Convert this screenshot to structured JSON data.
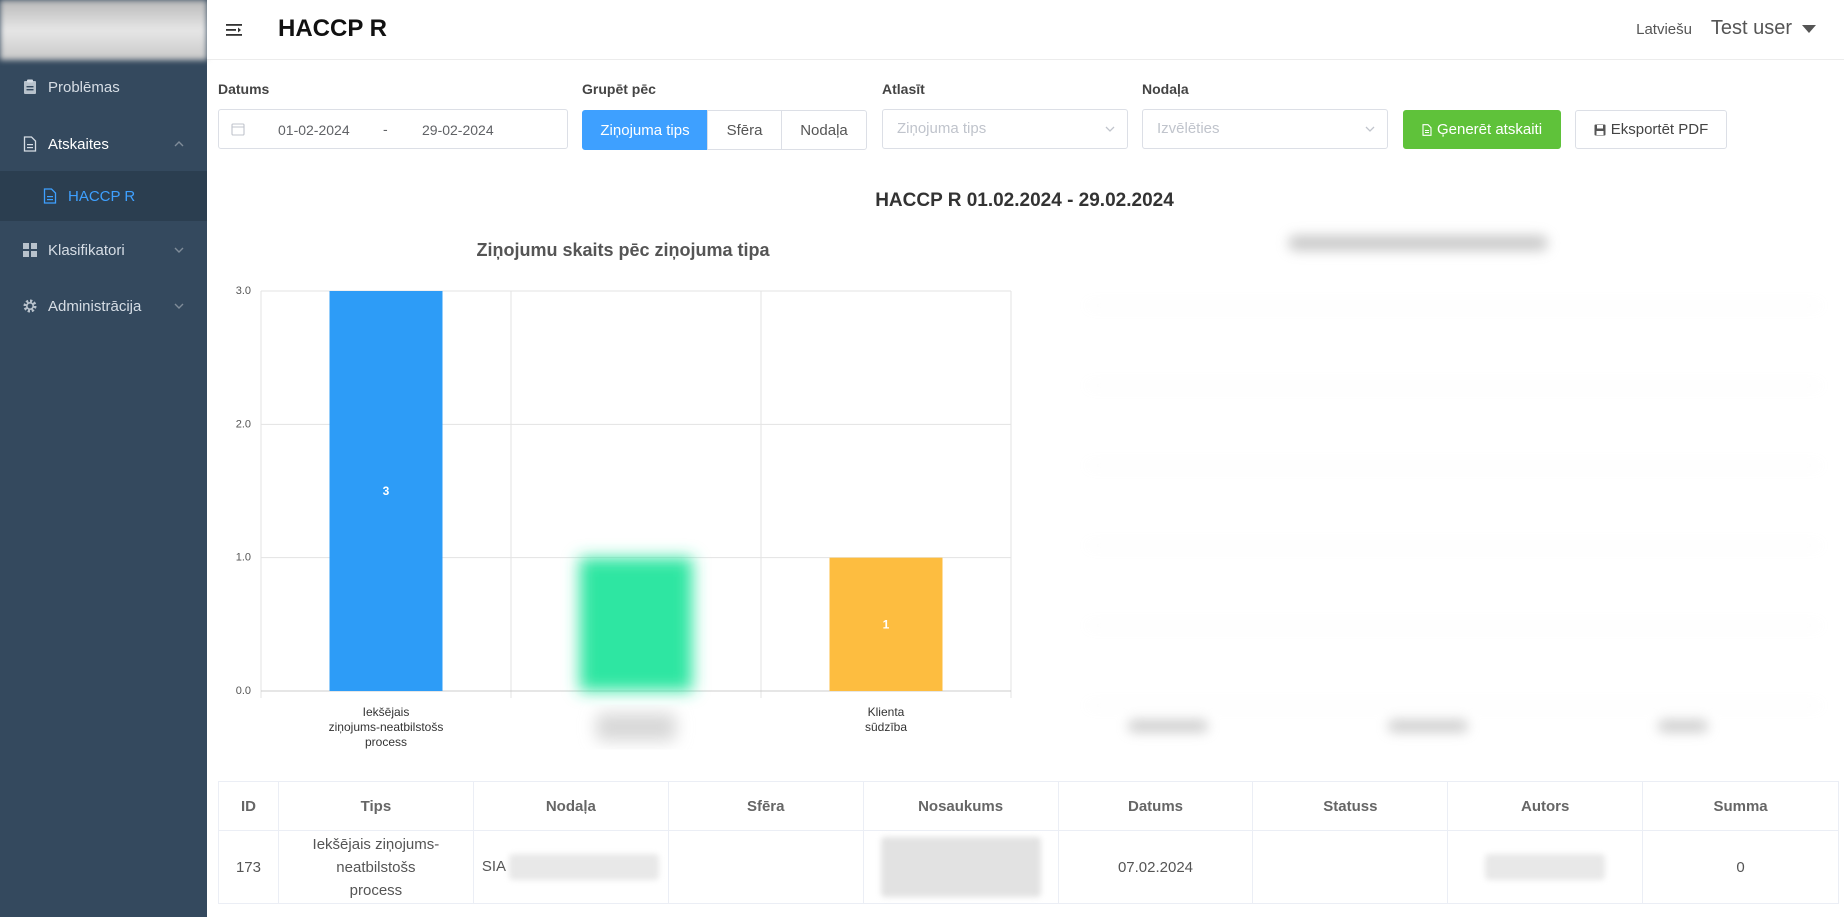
{
  "app": {
    "page_title": "HACCP R"
  },
  "header": {
    "language": "Latviešu",
    "user": "Test user"
  },
  "sidebar": {
    "items": [
      {
        "label": "Problēmas",
        "icon": "clipboard-icon"
      },
      {
        "label": "Atskaites",
        "icon": "document-icon"
      },
      {
        "label": "HACCP R",
        "icon": "file-icon"
      },
      {
        "label": "Klasifikatori",
        "icon": "grid-icon"
      },
      {
        "label": "Administrācija",
        "icon": "gear-icon"
      }
    ]
  },
  "filters": {
    "date_label": "Datums",
    "date_from": "01-02-2024",
    "date_separator": "-",
    "date_to": "29-02-2024",
    "group_label": "Grupēt pēc",
    "group_options": [
      "Ziņojuma tips",
      "Sfēra",
      "Nodaļa"
    ],
    "group_selected": "Ziņojuma tips",
    "select_label": "Atlasīt",
    "select_placeholder": "Ziņojuma tips",
    "department_label": "Nodaļa",
    "department_placeholder": "Izvēlēties",
    "generate_button": "Ģenerēt atskaiti",
    "export_button": "Eksportēt PDF"
  },
  "report": {
    "title": "HACCP R 01.02.2024 - 29.02.2024"
  },
  "chart_data": {
    "type": "bar",
    "title": "Ziņojumu skaits pēc ziņojuma tipa",
    "categories": [
      [
        "Iekšējais",
        "ziņojums-neatbilstošs",
        "process"
      ],
      [],
      [
        "Klienta",
        "sūdzība"
      ]
    ],
    "values": [
      3,
      1,
      1
    ],
    "data_labels": [
      "3",
      "",
      "1"
    ],
    "colors": [
      "#2d9cf7",
      "#2fe6a2",
      "#fdbd40"
    ],
    "blurred": [
      false,
      true,
      false
    ],
    "ylim": [
      0,
      3
    ],
    "yticks": [
      "0.0",
      "1.0",
      "2.0",
      "3.0"
    ],
    "grid": true
  },
  "table": {
    "columns": [
      "ID",
      "Tips",
      "Nodaļa",
      "Sfēra",
      "Nosaukums",
      "Datums",
      "Statuss",
      "Autors",
      "Summa"
    ],
    "rows": [
      {
        "id": "173",
        "tips": "Iekšējais ziņojums-neatbilstošs process",
        "nodala": "SIA",
        "sfera": "",
        "datums": "07.02.2024",
        "statuss": "",
        "summa": "0"
      }
    ]
  },
  "colors": {
    "sidebar_bg": "#34495e",
    "sidebar_active": "#3ea0ff",
    "primary": "#3ea0ff",
    "success": "#5fc23a"
  }
}
